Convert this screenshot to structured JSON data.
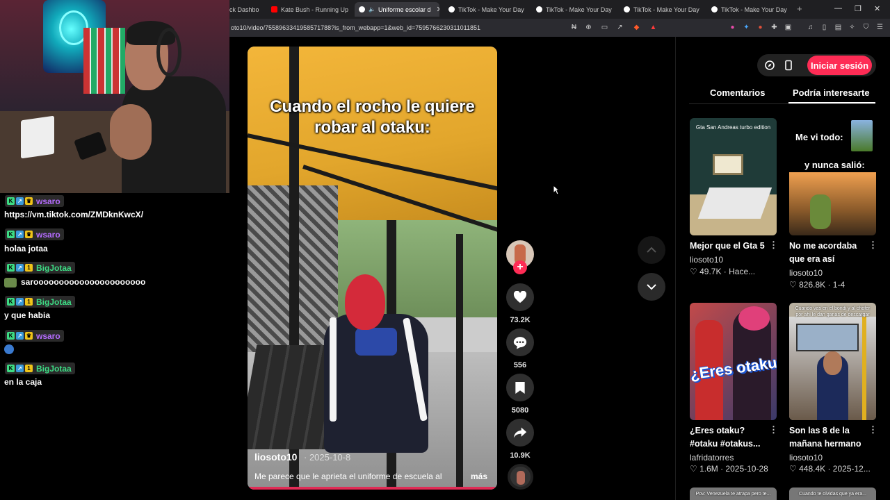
{
  "browser": {
    "tabs": [
      {
        "label": "ck Dashbo",
        "favicon_color": "#3c3c3c"
      },
      {
        "label": "Kate Bush - Running Up Th",
        "favicon_color": "#ff0000"
      },
      {
        "label": "Uniforme escolar d",
        "favicon_color": "#ffffff",
        "active": true
      },
      {
        "label": "TikTok - Make Your Day",
        "favicon_color": "#ffffff"
      },
      {
        "label": "TikTok - Make Your Day",
        "favicon_color": "#ffffff"
      },
      {
        "label": "TikTok - Make Your Day",
        "favicon_color": "#ffffff"
      },
      {
        "label": "TikTok - Make Your Day",
        "favicon_color": "#ffffff"
      }
    ],
    "url": "oto10/video/7558963341958571788?is_from_webapp=1&web_id=7595766230311011851"
  },
  "chat": {
    "messages": [
      {
        "user": "wsaro",
        "user_color": "#b56cff",
        "badge3": "crown",
        "text": "https://vm.tiktok.com/ZMDknKwcX/"
      },
      {
        "user": "wsaro",
        "user_color": "#b56cff",
        "badge3": "crown",
        "text": "holaa jotaa"
      },
      {
        "user": "BigJotaa",
        "user_color": "#3ddc84",
        "badge3": "1",
        "text": "saroooooooooooooooooooooo",
        "emote": true
      },
      {
        "user": "BigJotaa",
        "user_color": "#3ddc84",
        "badge3": "1",
        "text": "y que habia"
      },
      {
        "user": "wsaro",
        "user_color": "#b56cff",
        "badge3": "crown",
        "text": "",
        "emote": true
      },
      {
        "user": "BigJotaa",
        "user_color": "#3ddc84",
        "badge3": "1",
        "text": "en la caja"
      }
    ]
  },
  "video": {
    "caption_line1": "Cuando el rocho le quiere",
    "caption_line2": "robar al otaku:",
    "author": "liosoto10",
    "date": "· 2025-10-8",
    "description": "Me parece que le aprieta el uniforme de escuela al",
    "more": "más",
    "likes": "73.2K",
    "comments": "556",
    "saves": "5080",
    "shares": "10.9K",
    "follow_icon": "+"
  },
  "right_panel": {
    "login": "Iniciar sesión",
    "tab_comments": "Comentarios",
    "tab_suggested": "Podría interesarte",
    "cards": [
      {
        "title": "Mejor que el Gta 5",
        "author": "liosoto10",
        "stats": "♡ 49.7K · Hace...",
        "thumb_caption": "Gta San Andreas turbo edition"
      },
      {
        "title": "No me acordaba que era así",
        "author": "liosoto10",
        "stats": "♡ 826.8K · 1-4",
        "thumb_t1": "Me vi todo:",
        "thumb_t2": "y nunca salió:"
      },
      {
        "title": "¿Eres otaku? #otaku #otakus...",
        "author": "lafridatorres",
        "stats": "♡ 1.6M · 2025-10-28",
        "thumb_big": "¿Eres otaku?"
      },
      {
        "title": "Son las 8 de la mañana hermano",
        "author": "liosoto10",
        "stats": "♡ 448.4K · 2025-12...",
        "thumb_caption": "Cuando vas en el bondi y al chofer por ahi le dan ganas de descargar"
      }
    ],
    "strip1": "Pov: Venezuela te atrapa pero te...",
    "strip2": "Cuando te olvidas que ya era..."
  }
}
